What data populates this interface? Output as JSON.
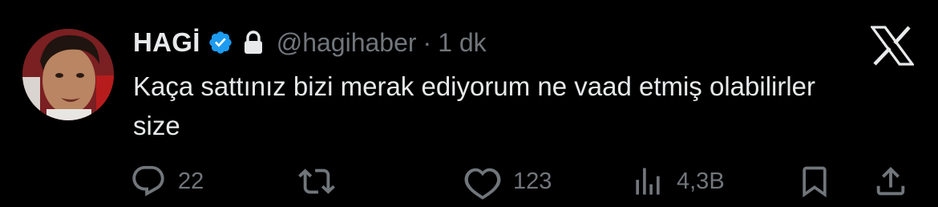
{
  "author": {
    "display_name": "HAGİ",
    "handle": "@hagihaber",
    "separator": "·",
    "time": "1 dk",
    "verified": true,
    "protected": true
  },
  "tweet": {
    "text": "Kaça sattınız bizi merak ediyorum ne vaad etmiş olabilirler size"
  },
  "actions": {
    "replies": "22",
    "retweets": "",
    "likes": "123",
    "views": "4,3B"
  },
  "icons": {
    "reply": "speech-bubble-icon",
    "retweet": "retweet-arrows-icon",
    "like": "heart-icon",
    "views": "bar-chart-icon",
    "bookmark": "bookmark-icon",
    "share": "share-upload-icon",
    "brand": "x-logo-icon",
    "verified": "verified-badge-icon",
    "protected": "lock-icon"
  },
  "colors": {
    "background": "#000000",
    "text_primary": "#e7e9ea",
    "text_secondary": "#71767b",
    "verified_blue": "#1d9bf0"
  }
}
